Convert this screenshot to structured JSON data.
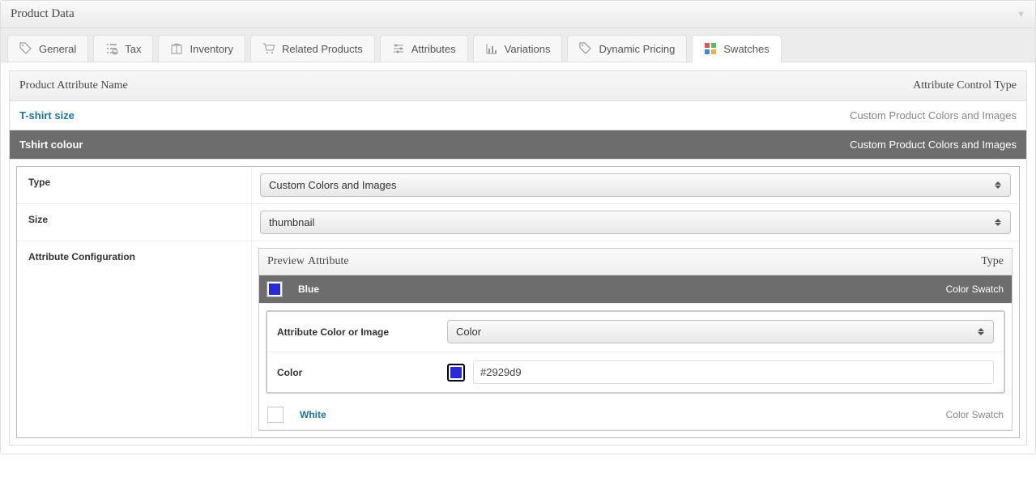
{
  "panel": {
    "title": "Product Data"
  },
  "tabs": [
    {
      "label": "General",
      "icon": "tag-icon"
    },
    {
      "label": "Tax",
      "icon": "list-icon"
    },
    {
      "label": "Inventory",
      "icon": "box-icon"
    },
    {
      "label": "Related Products",
      "icon": "cart-icon"
    },
    {
      "label": "Attributes",
      "icon": "sliders-icon"
    },
    {
      "label": "Variations",
      "icon": "chart-icon"
    },
    {
      "label": "Dynamic Pricing",
      "icon": "price-tag-icon"
    },
    {
      "label": "Swatches",
      "icon": "swatches-icon"
    }
  ],
  "table_header": {
    "name": "Product Attribute Name",
    "type": "Attribute Control Type"
  },
  "attributes": [
    {
      "name": "T-shirt size",
      "type": "Custom Product Colors and Images"
    },
    {
      "name": "Tshirt colour",
      "type": "Custom Product Colors and Images"
    }
  ],
  "fields": {
    "type_label": "Type",
    "type_value": "Custom Colors and Images",
    "size_label": "Size",
    "size_value": "thumbnail",
    "config_label": "Attribute Configuration"
  },
  "inner_header": {
    "preview": "Preview",
    "attribute": "Attribute",
    "type": "Type"
  },
  "swatches": [
    {
      "label": "Blue",
      "color": "#2929d9",
      "type": "Color Swatch"
    },
    {
      "label": "White",
      "color": "#ffffff",
      "type": "Color Swatch"
    }
  ],
  "detail": {
    "mode_label": "Attribute Color or Image",
    "mode_value": "Color",
    "color_label": "Color",
    "color_value": "#2929d9"
  }
}
